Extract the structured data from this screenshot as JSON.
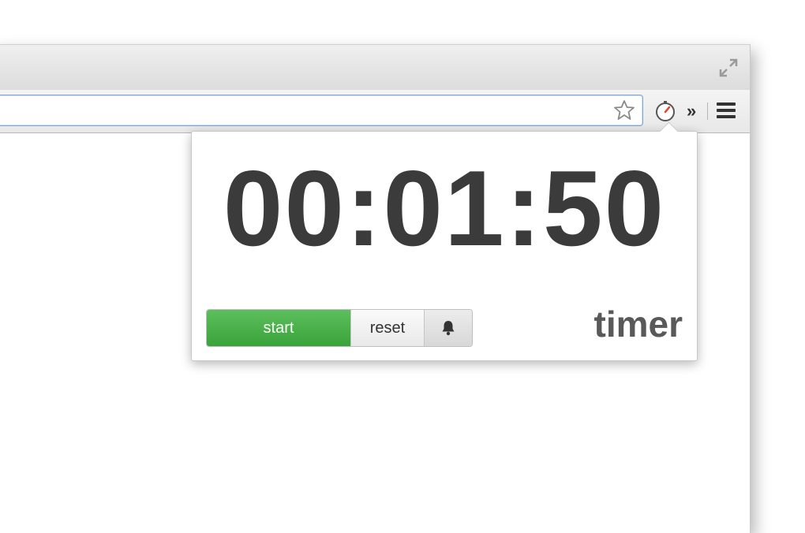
{
  "browser": {
    "icons": {
      "fullscreen": "fullscreen-arrows-icon",
      "bookmark": "star-icon",
      "extension": "timer-stopwatch-icon",
      "overflow": "double-chevron-right-icon",
      "menu": "hamburger-menu-icon"
    },
    "overflow_glyph": "»"
  },
  "popup": {
    "time": "00:01:50",
    "start_label": "start",
    "reset_label": "reset",
    "bell_icon": "bell-icon",
    "brand": "timer"
  },
  "colors": {
    "start_green": "#43aa43",
    "time_text": "#3b3b3b",
    "brand_text": "#595959",
    "omnibox_focus": "#7ea6d8",
    "extension_accent": "#e0432b"
  }
}
